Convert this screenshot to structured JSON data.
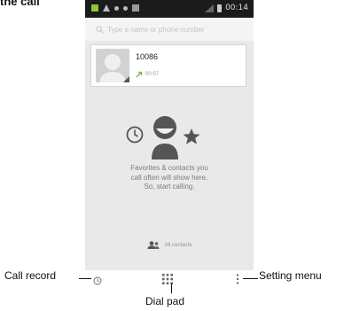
{
  "doc": {
    "heading": "the call"
  },
  "status_bar": {
    "time": "00:14"
  },
  "search": {
    "placeholder": "Type a name or phone number"
  },
  "recent": {
    "number": "10086",
    "duration": "00:07"
  },
  "favorites": {
    "empty_line1": "Favorites & contacts you",
    "empty_line2": "call often will show here.",
    "empty_line3": "So, start calling."
  },
  "all_contacts": {
    "label": "All contacts"
  },
  "annotations": {
    "call_record": "Call record",
    "dial_pad": "Dial pad",
    "setting_menu": "Setting menu"
  },
  "colors": {
    "status_bar_bg": "#1b1b1b",
    "screen_bg": "#e9e9e9",
    "illustration_dark": "#555555",
    "outgoing_arrow": "#7cb342"
  },
  "icons": {
    "search": "search-icon",
    "call_record": "clock-icon",
    "dial_pad": "dialpad-grid-icon",
    "menu": "overflow-menu-icon",
    "outgoing": "outgoing-call-icon",
    "contacts": "contacts-icon",
    "star": "star-icon"
  }
}
